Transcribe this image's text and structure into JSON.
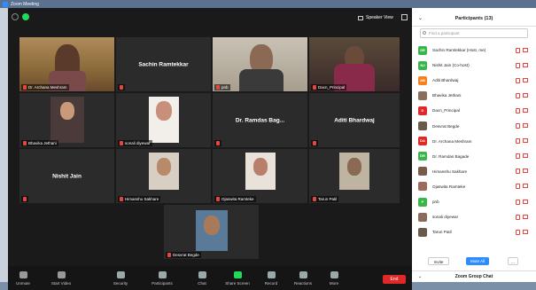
{
  "window": {
    "title": "Zoom Meeting"
  },
  "topbar": {
    "speaker_view_label": "Speaker View"
  },
  "tiles": [
    {
      "name": "Dr. Archana Meshram",
      "type": "video"
    },
    {
      "name": "Sachin Ramtekkar",
      "type": "name"
    },
    {
      "name": "pnb",
      "type": "video"
    },
    {
      "name": "Dacn_Principal",
      "type": "video"
    },
    {
      "name": "Bhavika Jethani",
      "type": "video"
    },
    {
      "name": "sonali diyewar",
      "type": "video"
    },
    {
      "name": "Dr. Ramdas Bag...",
      "type": "name"
    },
    {
      "name": "Aditi Bhardwaj",
      "type": "name"
    },
    {
      "name": "Nishit Jain",
      "type": "name"
    },
    {
      "name": "Himanshu Sakhare",
      "type": "video"
    },
    {
      "name": "Ojaswita Ramteke",
      "type": "video"
    },
    {
      "name": "Tarun Patil",
      "type": "video"
    },
    {
      "name": "Desvrat Begde",
      "type": "video"
    }
  ],
  "toolbar": {
    "unmute": "Unmute",
    "start_video": "Start Video",
    "security": "Security",
    "participants": "Participants",
    "participants_count": "13",
    "chat": "Chat",
    "share_screen": "Share Screen",
    "record": "Record",
    "reactions": "Reactions",
    "more": "More",
    "end": "End"
  },
  "panel": {
    "title": "Participants (13)",
    "search_placeholder": "Find a participant",
    "participants": [
      {
        "initials": "SR",
        "name": "Sachin Ramtekkar (Host, me)",
        "color": "#3ab54a"
      },
      {
        "initials": "NJ",
        "name": "Nishit Jain (Co-host)",
        "color": "#3ab54a"
      },
      {
        "initials": "AB",
        "name": "Aditi Bhardwaj",
        "color": "#f58220"
      },
      {
        "initials": "",
        "name": "Bhavika Jethani",
        "color": "#8a6d5a"
      },
      {
        "initials": "D",
        "name": "Dacn_Principal",
        "color": "#e02828"
      },
      {
        "initials": "",
        "name": "Desvrat Begde",
        "color": "#6a5a4a"
      },
      {
        "initials": "DA",
        "name": "Dr. Archana Meshram",
        "color": "#e02828"
      },
      {
        "initials": "DR",
        "name": "Dr. Ramdas Bagade",
        "color": "#3ab54a"
      },
      {
        "initials": "",
        "name": "Himanshu Sakhare",
        "color": "#7a5a4a"
      },
      {
        "initials": "",
        "name": "Ojaswita Ramteke",
        "color": "#9a6a5a"
      },
      {
        "initials": "P",
        "name": "pnb",
        "color": "#3ab54a"
      },
      {
        "initials": "",
        "name": "sonali diyewar",
        "color": "#8a6a5a"
      },
      {
        "initials": "",
        "name": "Tarun Patil",
        "color": "#6a5a4a"
      }
    ],
    "invite": "Invite",
    "mute_all": "Mute All",
    "more": "...",
    "group_chat": "Zoom Group Chat"
  }
}
